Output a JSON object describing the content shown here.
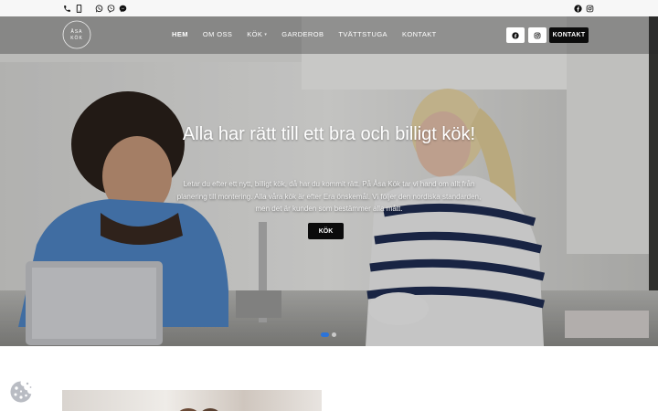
{
  "topbar": {
    "left_icons": [
      "phone-icon",
      "mobile-phone-icon",
      "whatsapp-icon",
      "viber-icon",
      "messenger-icon"
    ],
    "right_icons": [
      "facebook-icon",
      "instagram-icon"
    ]
  },
  "nav": {
    "logo_text_top": "ÅSA",
    "logo_text_bottom": "KÖK",
    "items": [
      {
        "label": "HEM",
        "active": true
      },
      {
        "label": "OM OSS",
        "active": false
      },
      {
        "label": "KÖK",
        "active": false,
        "has_dropdown": true
      },
      {
        "label": "GARDEROB",
        "active": false
      },
      {
        "label": "TVÄTTSTUGA",
        "active": false
      },
      {
        "label": "KONTAKT",
        "active": false
      }
    ],
    "social_icons": [
      "facebook-icon",
      "instagram-icon"
    ],
    "contact_button": "KONTAKT"
  },
  "hero": {
    "title": "Alla har rätt till ett bra och billigt kök!",
    "description": "Letar du efter ett nytt, billigt kök, då har du kommit rätt. På Åsa Kök tar vi hand om allt från planering till montering. Alla våra kök är efter Era önskemål. Vi följer den nordiska standarden, men det är kunden som bestämmer alla mått.",
    "button": "KÖK",
    "slider_active": 1,
    "slider_count": 2
  },
  "colors": {
    "accent_dot": "#2b73d8",
    "button_bg": "#0b0b0b",
    "topbar_bg": "#f7f7f7"
  },
  "cookie_icon": "cookie-icon"
}
